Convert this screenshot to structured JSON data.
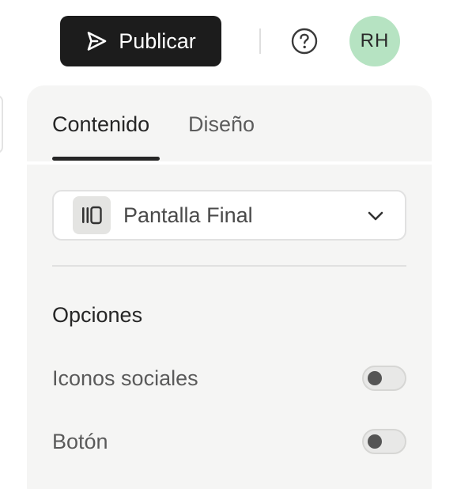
{
  "header": {
    "publish_label": "Publicar",
    "publish_icon": "send-icon",
    "help_icon": "help-circle-icon",
    "avatar_initials": "RH",
    "avatar_color": "#b6e3c2"
  },
  "panel": {
    "tabs": [
      {
        "label": "Contenido",
        "active": true
      },
      {
        "label": "Diseño",
        "active": false
      }
    ],
    "screen_select": {
      "icon": "final-screen-icon",
      "value": "Pantalla Final",
      "chevron_icon": "chevron-down-icon"
    },
    "options": {
      "title": "Opciones",
      "items": [
        {
          "label": "Iconos sociales",
          "enabled": false
        },
        {
          "label": "Botón",
          "enabled": false
        }
      ]
    }
  },
  "colors": {
    "primary_button": "#1c1c1c",
    "panel_background": "#f5f5f4",
    "toggle_off": "#e8e8e7"
  }
}
